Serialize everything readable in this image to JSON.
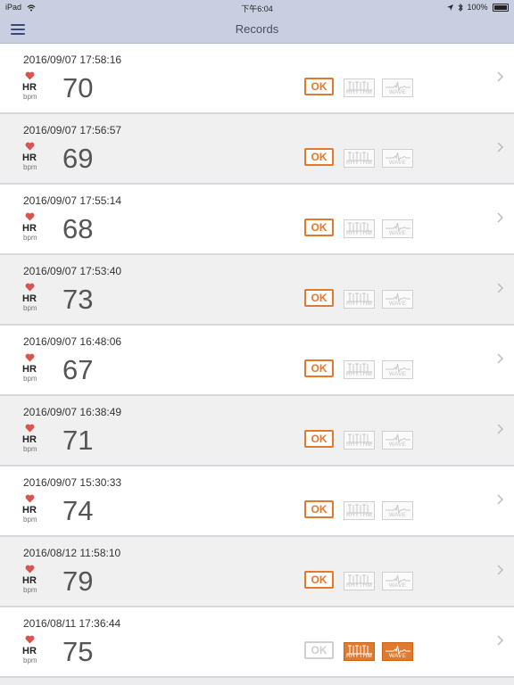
{
  "status": {
    "carrier": "iPad",
    "time": "下午6:04",
    "battery": "100%"
  },
  "nav": {
    "title": "Records",
    "menu_icon": "hamburger-menu-icon"
  },
  "labels": {
    "hr": "HR",
    "bpm": "bpm",
    "ok": "OK",
    "rhythm": "RHYTHM",
    "wave": "WAVE"
  },
  "records": [
    {
      "datetime": "2016/09/07 17:58:16",
      "hr": "70",
      "ok_active": true,
      "rhythm_active": false,
      "wave_active": false
    },
    {
      "datetime": "2016/09/07 17:56:57",
      "hr": "69",
      "ok_active": true,
      "rhythm_active": false,
      "wave_active": false
    },
    {
      "datetime": "2016/09/07 17:55:14",
      "hr": "68",
      "ok_active": true,
      "rhythm_active": false,
      "wave_active": false
    },
    {
      "datetime": "2016/09/07 17:53:40",
      "hr": "73",
      "ok_active": true,
      "rhythm_active": false,
      "wave_active": false
    },
    {
      "datetime": "2016/09/07 16:48:06",
      "hr": "67",
      "ok_active": true,
      "rhythm_active": false,
      "wave_active": false
    },
    {
      "datetime": "2016/09/07 16:38:49",
      "hr": "71",
      "ok_active": true,
      "rhythm_active": false,
      "wave_active": false
    },
    {
      "datetime": "2016/09/07 15:30:33",
      "hr": "74",
      "ok_active": true,
      "rhythm_active": false,
      "wave_active": false
    },
    {
      "datetime": "2016/08/12 11:58:10",
      "hr": "79",
      "ok_active": true,
      "rhythm_active": false,
      "wave_active": false
    },
    {
      "datetime": "2016/08/11 17:36:44",
      "hr": "75",
      "ok_active": false,
      "rhythm_active": true,
      "wave_active": true
    }
  ],
  "colors": {
    "accent": "#e07a2e",
    "heart": "#d9534f",
    "nav_bg": "#c9cfe0"
  }
}
